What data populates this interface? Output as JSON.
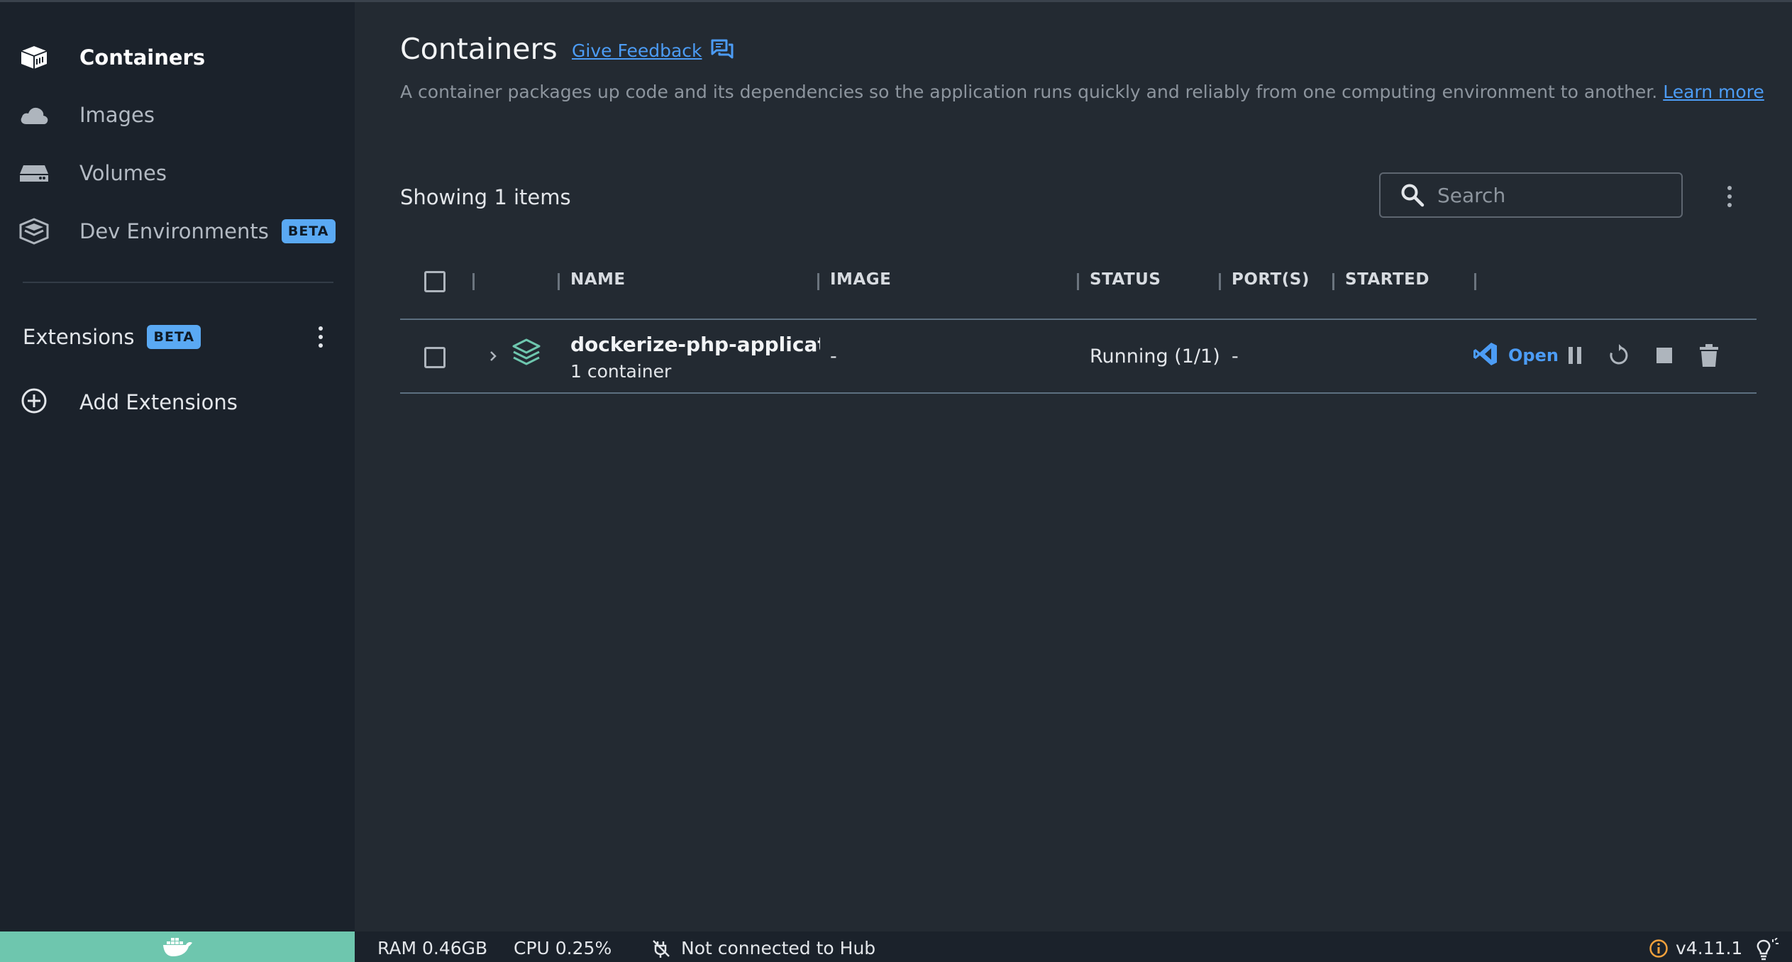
{
  "sidebar": {
    "items": [
      {
        "label": "Containers",
        "icon": "container-icon",
        "active": true
      },
      {
        "label": "Images",
        "icon": "cloud-icon"
      },
      {
        "label": "Volumes",
        "icon": "volume-icon"
      },
      {
        "label": "Dev Environments",
        "icon": "dev-env-icon",
        "badge": "BETA"
      }
    ],
    "extensions": {
      "label": "Extensions",
      "badge": "BETA"
    },
    "add_extensions": "Add Extensions"
  },
  "main": {
    "title": "Containers",
    "feedback": "Give Feedback",
    "description": "A container packages up code and its dependencies so the application runs quickly and reliably from one computing environment to another.",
    "learn_more": "Learn more",
    "showing": "Showing 1 items",
    "search_placeholder": "Search",
    "columns": [
      "NAME",
      "IMAGE",
      "STATUS",
      "PORT(S)",
      "STARTED"
    ],
    "rows": [
      {
        "name": "dockerize-php-applicatior",
        "sub": "1 container",
        "image": "-",
        "status": "Running (1/1)",
        "ports": "-",
        "started": "",
        "open_label": "Open"
      }
    ]
  },
  "footer": {
    "ram": "RAM 0.46GB",
    "cpu": "CPU 0.25%",
    "hub": "Not connected to Hub",
    "version": "v4.11.1"
  },
  "colors": {
    "accent": "#4c9cf5",
    "sidebar_bg": "#1b222b",
    "main_bg": "#232a32",
    "whale_bar": "#6ec6ae",
    "stack_icon": "#6ec6ae"
  }
}
